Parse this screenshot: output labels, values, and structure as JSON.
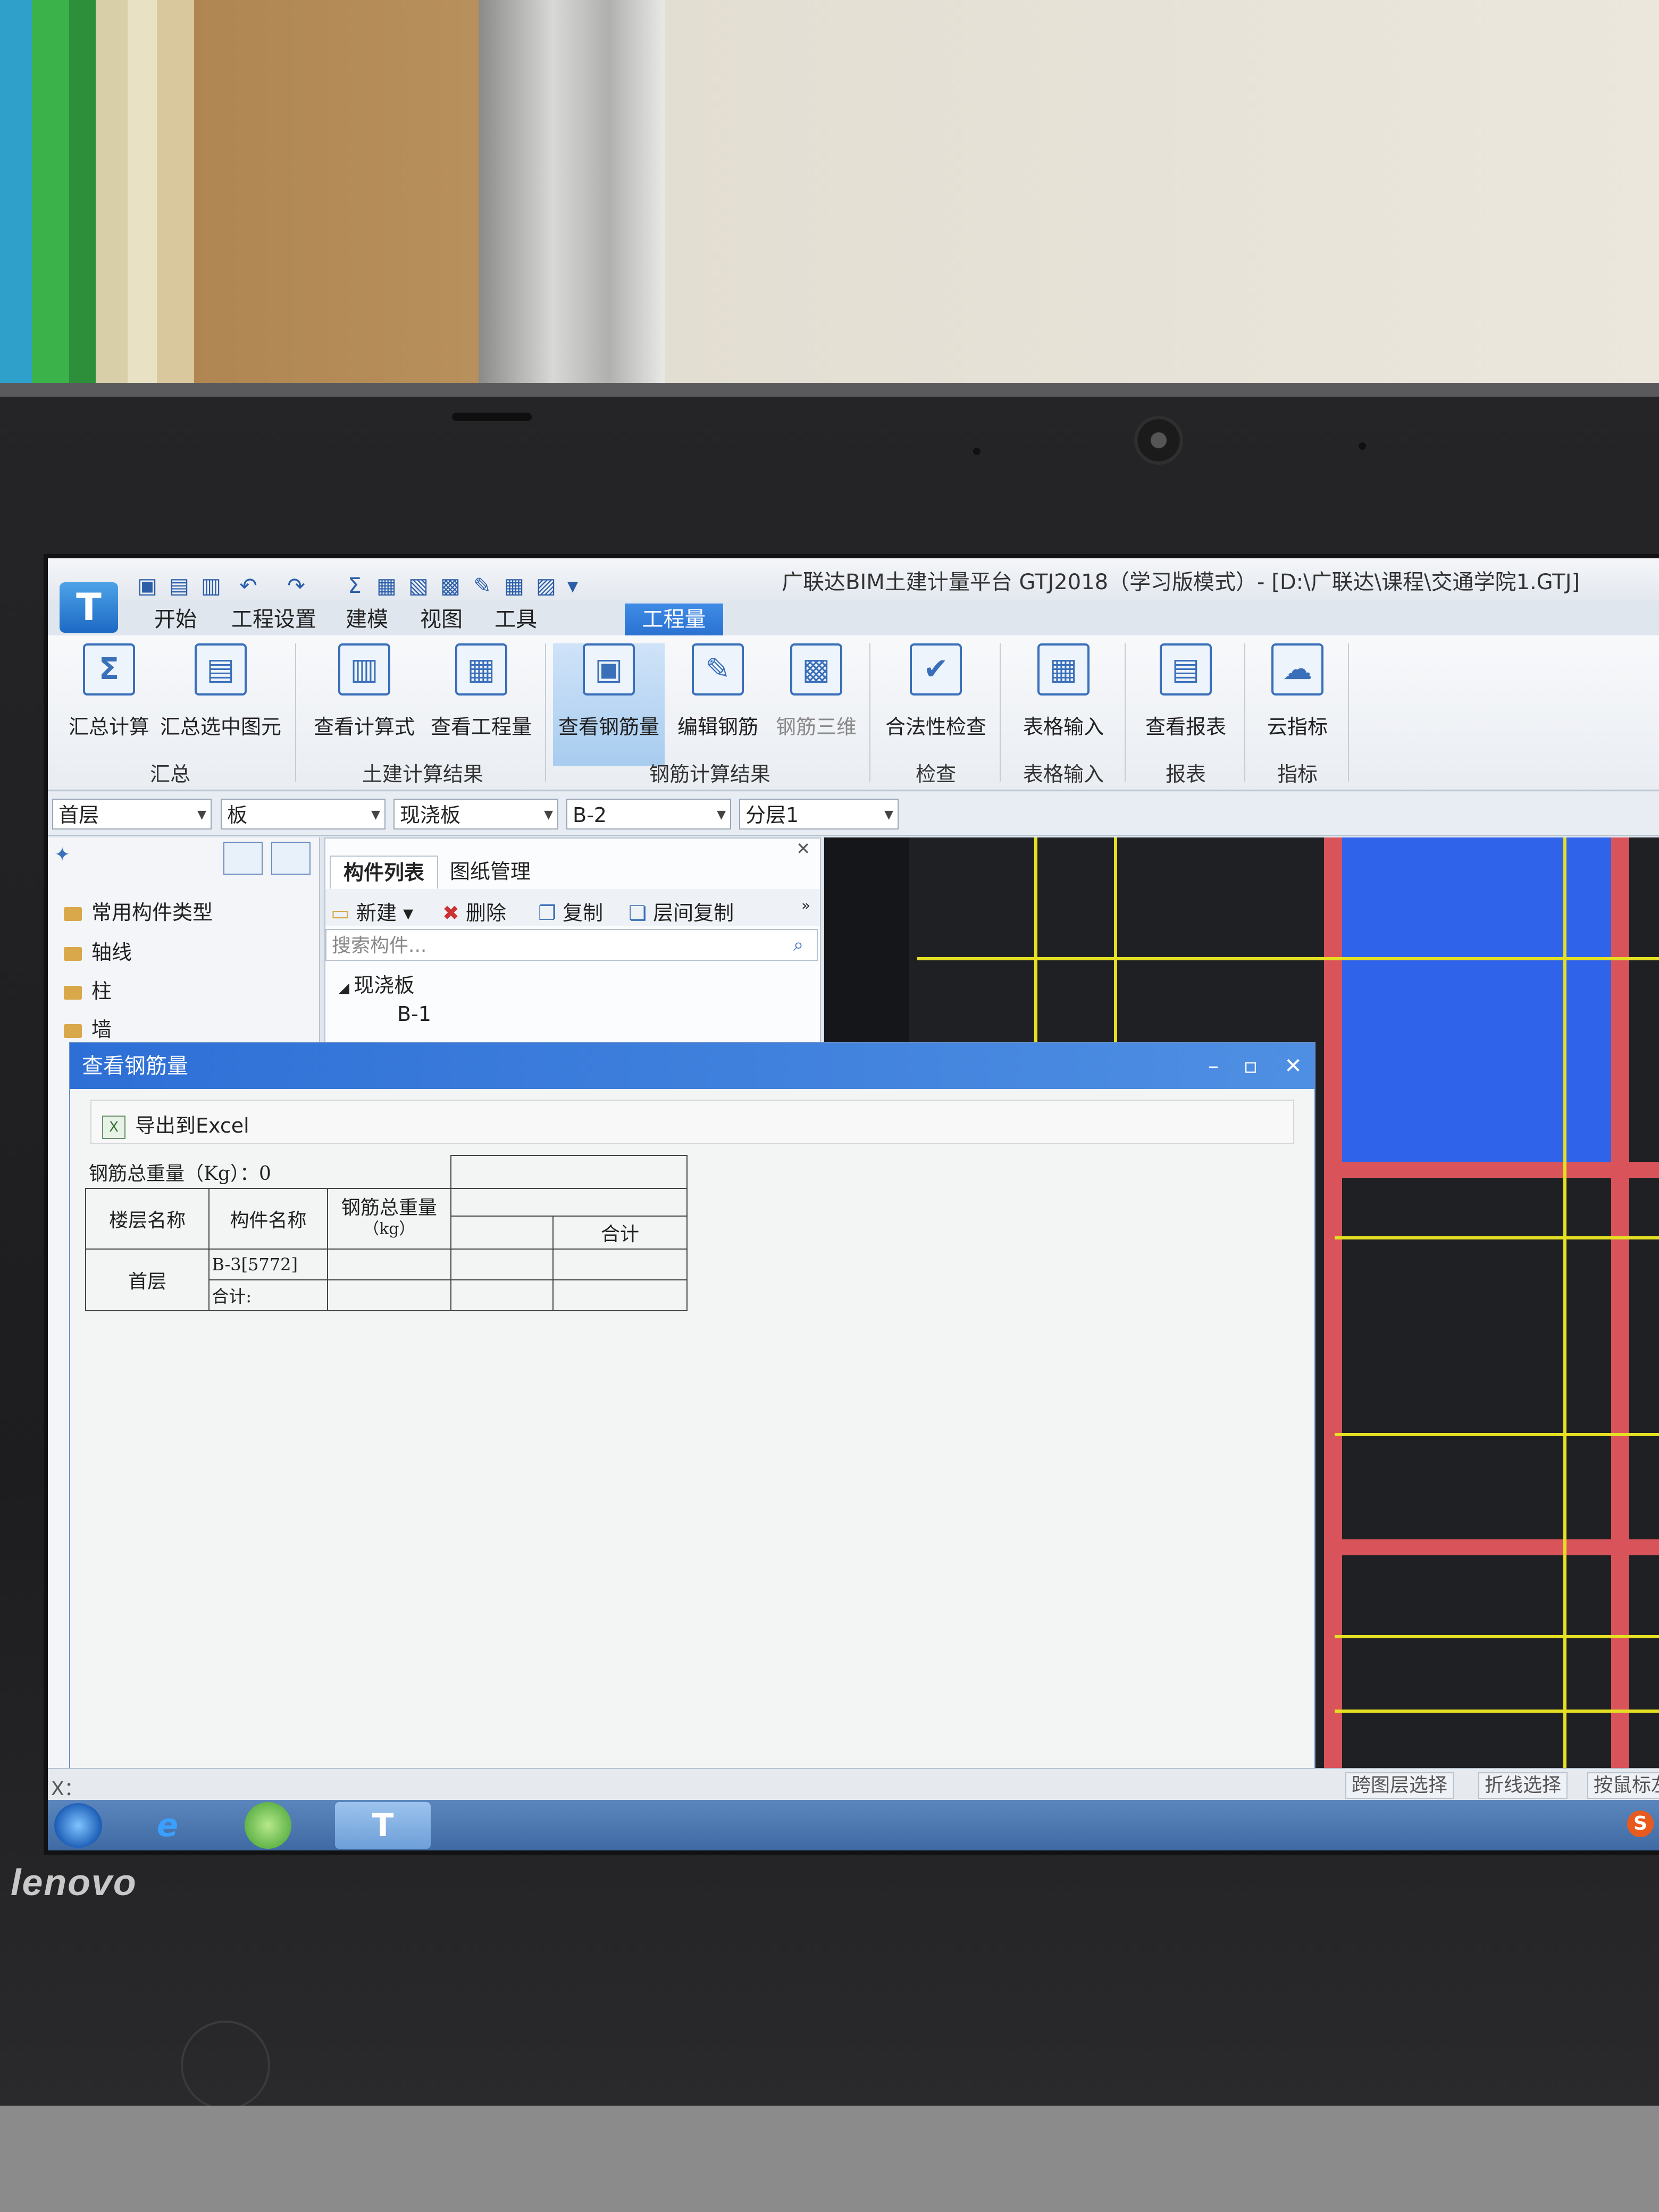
{
  "window": {
    "title": "广联达BIM土建计量平台 GTJ2018（学习版模式）- [D:\\广联达\\课程\\交通学院1.GTJ]",
    "logo_glyph": "T"
  },
  "quick_access": {
    "icons": [
      "save-icon",
      "save-as-icon",
      "open-icon",
      "undo-icon",
      "redo-icon",
      "sigma-icon",
      "view-formula-icon",
      "view-quantity-icon",
      "view-rebar-icon",
      "edit-icon",
      "grid-icon",
      "print-icon",
      "dropdown-icon"
    ],
    "glyphs": [
      "▣",
      "▤",
      "▥",
      "↶",
      "↷",
      "Σ",
      "▦",
      "▧",
      "▩",
      "✎",
      "▦",
      "▨",
      "▾"
    ]
  },
  "tabs": [
    "开始",
    "工程设置",
    "建模",
    "视图",
    "工具",
    "工程量"
  ],
  "active_tab": "工程量",
  "ribbon": {
    "buttons": [
      {
        "label": "汇总计算",
        "glyph": "Σ",
        "icon": "sigma-icon"
      },
      {
        "label": "汇总选中图元",
        "glyph": "▤",
        "icon": "calculator-icon"
      },
      {
        "label": "查看计算式",
        "glyph": "▥",
        "icon": "formula-search-icon"
      },
      {
        "label": "查看工程量",
        "glyph": "▦",
        "icon": "quantity-search-icon"
      },
      {
        "label": "查看钢筋量",
        "glyph": "▣",
        "icon": "rebar-glasses-icon"
      },
      {
        "label": "编辑钢筋",
        "glyph": "✎",
        "icon": "edit-rebar-icon"
      },
      {
        "label": "钢筋三维",
        "glyph": "▩",
        "icon": "rebar-3d-icon"
      },
      {
        "label": "合法性检查",
        "glyph": "✔",
        "icon": "check-icon"
      },
      {
        "label": "表格输入",
        "glyph": "▦",
        "icon": "table-edit-icon"
      },
      {
        "label": "查看报表",
        "glyph": "▤",
        "icon": "report-icon"
      },
      {
        "label": "云指标",
        "glyph": "☁",
        "icon": "cloud-icon"
      }
    ],
    "groups": [
      "汇总",
      "土建计算结果",
      "钢筋计算结果",
      "检查",
      "表格输入",
      "报表",
      "指标"
    ]
  },
  "selectors": [
    "首层",
    "板",
    "现浇板",
    "B-2",
    "分层1"
  ],
  "left_nav": {
    "items": [
      "常用构件类型",
      "轴线",
      "柱",
      "墙"
    ]
  },
  "component_panel": {
    "tabs": [
      "构件列表",
      "图纸管理"
    ],
    "tools": [
      "新建",
      "删除",
      "复制",
      "层间复制"
    ],
    "search_placeholder": "搜索构件...",
    "tree": {
      "group": "现浇板",
      "items": [
        "B-1"
      ]
    }
  },
  "dialog": {
    "title": "查看钢筋量",
    "export_label": "导出到Excel",
    "total_weight": "钢筋总重量（Kg）：0",
    "headers": {
      "floor": "楼层名称",
      "component": "构件名称",
      "weight": "钢筋总重量",
      "weight_unit": "（kg）",
      "subtotal": "合计"
    },
    "rows": [
      {
        "floor": "首层",
        "component": "B-3[5772]"
      },
      {
        "component": "合计:"
      }
    ]
  },
  "statusbar": {
    "coord_label": "X：",
    "buttons": [
      "跨图层选择",
      "折线选择",
      "按鼠标左"
    ]
  },
  "laptop_brand": "lenovo",
  "ime_glyph": "S",
  "colors": {
    "ribbon_active": "#2b72d1",
    "canvas_bg": "#1e2024",
    "grid_line": "#e6e023",
    "beam": "#d9545a",
    "slab": "#2f63ea",
    "dialog_title": "#2d6fd6"
  }
}
